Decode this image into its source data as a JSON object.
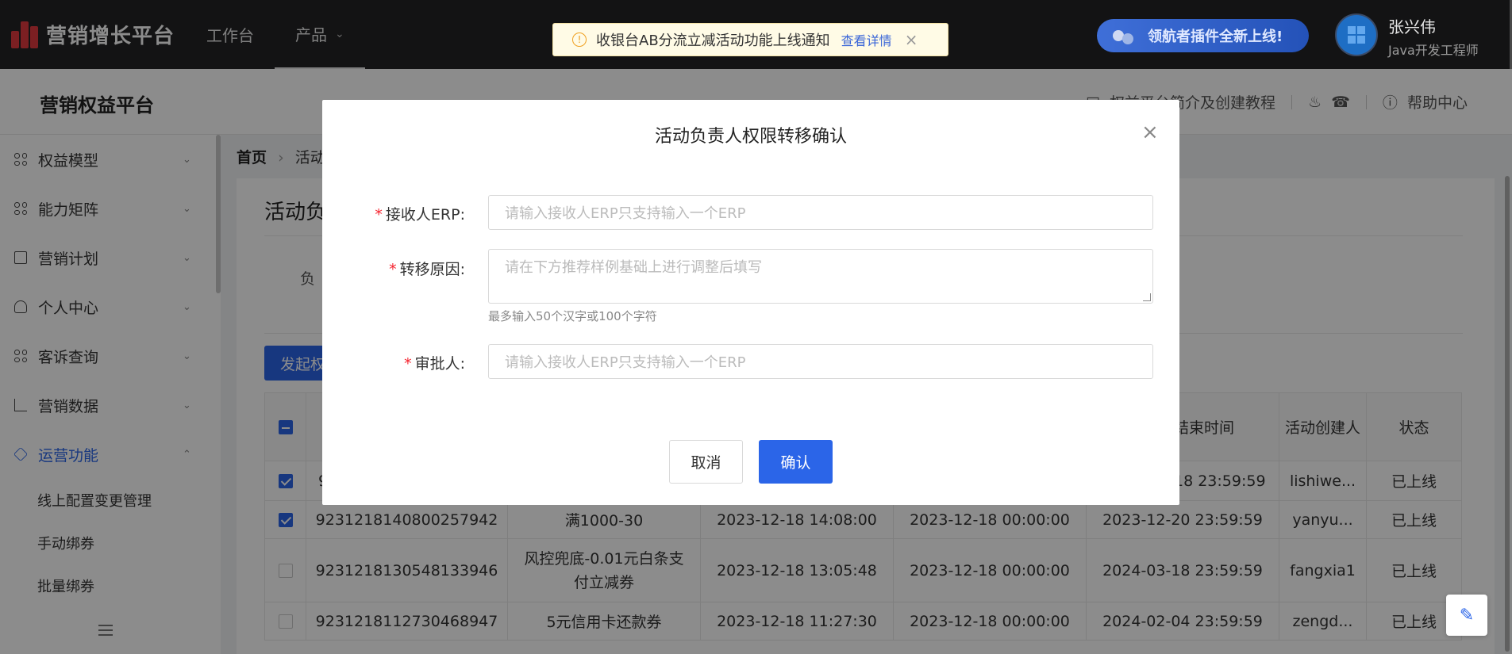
{
  "topnav": {
    "brand": "营销增长平台",
    "items": [
      {
        "label": "工作台"
      },
      {
        "label": "产品"
      }
    ],
    "notice_text": "收银台AB分流立减活动功能上线通知",
    "notice_link": "查看详情",
    "plugin_text": "领航者插件全新上线!",
    "user_name": "张兴伟",
    "user_role": "Java开发工程师"
  },
  "subheader": {
    "title": "营销权益平台",
    "intro_link": "权益平台简介及创建教程",
    "help": "帮助中心"
  },
  "sidebar": {
    "items": [
      {
        "label": "权益模型"
      },
      {
        "label": "能力矩阵"
      },
      {
        "label": "营销计划"
      },
      {
        "label": "个人中心"
      },
      {
        "label": "客诉查询"
      },
      {
        "label": "营销数据"
      },
      {
        "label": "运营功能"
      }
    ],
    "subitems": [
      {
        "label": "线上配置变更管理"
      },
      {
        "label": "手动绑券"
      },
      {
        "label": "批量绑券"
      }
    ]
  },
  "main": {
    "crumb_home": "首页",
    "crumb_current": "活动",
    "page_title": "活动负",
    "filter_label": "负",
    "action_button": "发起权",
    "table": {
      "headers": [
        "",
        "",
        "",
        "",
        "",
        "结束时间",
        "活动创建人",
        "状态"
      ],
      "rows": [
        {
          "id": "9",
          "name": "",
          "created": "",
          "start": "",
          "end": "18 23:59:59",
          "creator": "lishiwe...",
          "status": "已上线",
          "checked": true
        },
        {
          "id": "9231218140800257942",
          "name": "满1000-30",
          "created": "2023-12-18 14:08:00",
          "start": "2023-12-18 00:00:00",
          "end": "2023-12-20 23:59:59",
          "creator": "yanyu...",
          "status": "已上线",
          "checked": true
        },
        {
          "id": "9231218130548133946",
          "name": "风控兜底-0.01元白条支付立减券",
          "created": "2023-12-18 13:05:48",
          "start": "2023-12-18 00:00:00",
          "end": "2024-03-18 23:59:59",
          "creator": "fangxia1",
          "status": "已上线",
          "checked": false
        },
        {
          "id": "9231218112730468947",
          "name": "5元信用卡还款券",
          "created": "2023-12-18 11:27:30",
          "start": "2023-12-18 00:00:00",
          "end": "2024-02-04 23:59:59",
          "creator": "zengd...",
          "status": "已上线",
          "checked": false
        }
      ]
    }
  },
  "modal": {
    "title": "活动负责人权限转移确认",
    "receiver_label": "接收人ERP:",
    "receiver_placeholder": "请输入接收人ERP只支持输入一个ERP",
    "reason_label": "转移原因:",
    "reason_placeholder": "请在下方推荐样例基础上进行调整后填写",
    "reason_help": "最多输入50个汉字或100个字符",
    "approver_label": "审批人:",
    "approver_placeholder": "请输入接收人ERP只支持输入一个ERP",
    "cancel": "取消",
    "confirm": "确认"
  },
  "colors": {
    "primary": "#2b65e8",
    "nav_bg": "#232425",
    "required": "#f5222d"
  }
}
